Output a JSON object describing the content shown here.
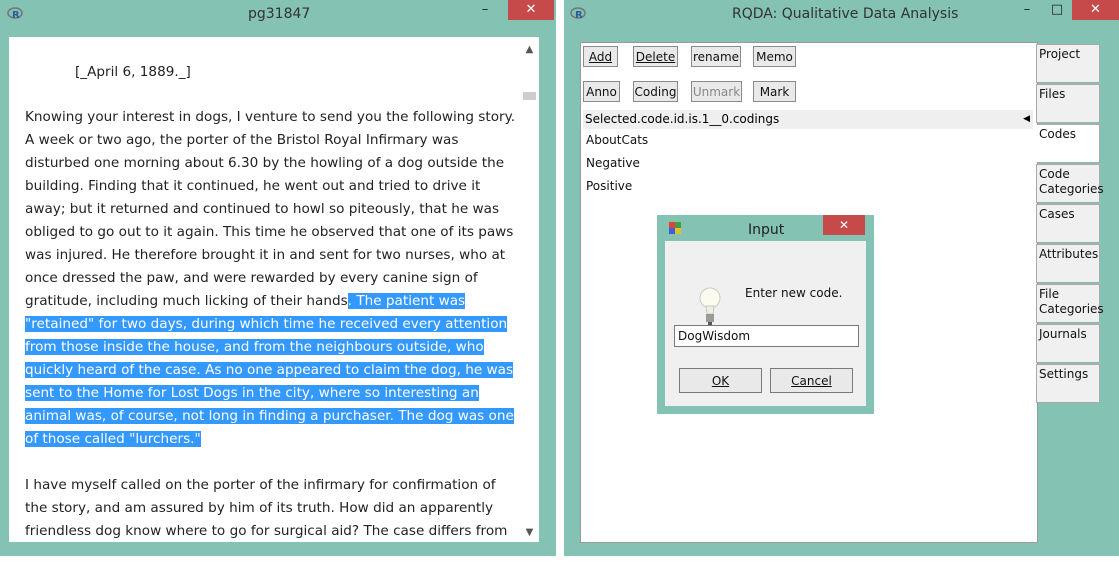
{
  "editor": {
    "title": "pg31847",
    "paragraphs": {
      "date": "[_April 6, 1889._]",
      "p1_plain": "Knowing your interest in dogs, I venture to send you the following story. A week or two ago, the porter of the Bristol Royal Infirmary was disturbed one morning about 6.30 by the howling of a dog outside the building. Finding that it continued, he went out and tried to drive it away; but it returned and continued to howl so piteously, that he was obliged to go out to it again. This time he observed that one of its paws was injured. He therefore brought it in and sent for two nurses, who at once dressed the paw, and were rewarded by every canine sign of gratitude, including much licking of their hands",
      "p1_selected": ". The patient was \"retained\" for two days, during which time he received every attention from those inside the house, and from the neighbours outside, who quickly heard of the case. As no one appeared to claim the dog, he was sent to the Home for Lost Dogs in the city, where so interesting an animal was, of course, not long in finding a purchaser. The dog was one of those called \"lurchers.\"",
      "p2": "I have myself called on the porter of the infirmary for confirmation of the story, and am assured by him of its truth. How did an apparently friendless dog know where to go for surgical aid? The case differs from"
    },
    "scroll_up": "▲",
    "scroll_down": "▼"
  },
  "rqda": {
    "title": "RQDA: Qualitative Data Analysis",
    "buttons": {
      "add": "Add",
      "delete": "Delete",
      "rename": "rename",
      "memo": "Memo",
      "anno": "Anno",
      "coding": "Coding",
      "unmark": "Unmark",
      "mark": "Mark"
    },
    "list_header": "Selected.code.id.is.1__0.codings",
    "codes": [
      "AboutCats",
      "Negative",
      "Positive"
    ],
    "tabs": [
      "Project",
      "Files",
      "Codes",
      "Code Categories",
      "Cases",
      "Attributes",
      "File Categories",
      "Journals",
      "Settings"
    ]
  },
  "dialog": {
    "title": "Input",
    "prompt": "Enter new code.",
    "input_value": "DogWisdom",
    "ok_label": "OK",
    "cancel_label": "Cancel",
    "close_glyph": "✕"
  },
  "window_controls": {
    "minimize": "–",
    "maximize": "□",
    "close": "✕"
  },
  "colors": {
    "frame": "#84c2b3",
    "selection": "#3399ff",
    "close": "#c74a4a"
  }
}
